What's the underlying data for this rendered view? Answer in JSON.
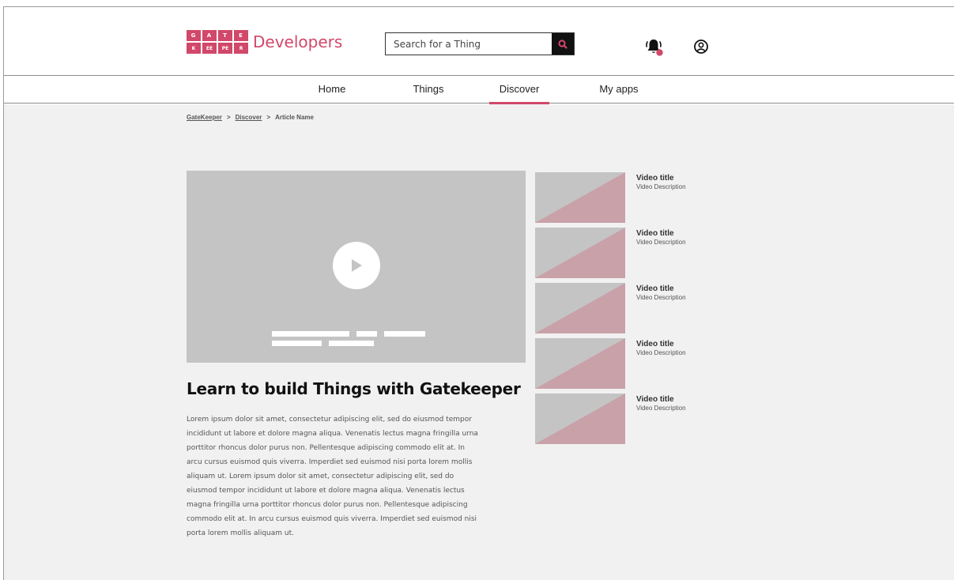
{
  "brand": {
    "logo_letters": [
      "G",
      "A",
      "T",
      "E",
      "K",
      "E",
      "E",
      "P",
      "E",
      "R"
    ],
    "name": "Developers",
    "accent_color": "#d1486a"
  },
  "search": {
    "placeholder": "Search for a Thing",
    "icon": "search-icon"
  },
  "header_icons": {
    "notifications": "bell-icon",
    "account": "account-icon"
  },
  "nav": {
    "items": [
      {
        "label": "Home",
        "active": false
      },
      {
        "label": "Things",
        "active": false
      },
      {
        "label": "Discover",
        "active": true
      },
      {
        "label": "My apps",
        "active": false
      }
    ]
  },
  "breadcrumb": {
    "items": [
      "GateKeeper",
      "Discover",
      "Article Name"
    ],
    "separator": ">"
  },
  "article": {
    "title": "Learn to build Things with Gatekeeper",
    "body": "Lorem ipsum dolor sit amet, consectetur adipiscing elit, sed do eiusmod tempor incididunt ut labore et dolore magna aliqua. Venenatis lectus magna fringilla urna porttitor rhoncus dolor purus non. Pellentesque adipiscing commodo elit at. In arcu cursus euismod quis viverra. Imperdiet sed euismod nisi porta lorem mollis aliquam ut.  Lorem ipsum dolor sit amet, consectetur adipiscing elit, sed do eiusmod tempor incididunt ut labore et dolore magna aliqua. Venenatis lectus magna fringilla urna porttitor rhoncus dolor purus non. Pellentesque adipiscing commodo elit at. In arcu cursus euismod quis viverra. Imperdiet sed euismod nisi porta lorem mollis aliquam ut."
  },
  "videos": [
    {
      "title": "Video title",
      "description": "Video Description"
    },
    {
      "title": "Video title",
      "description": "Video Description"
    },
    {
      "title": "Video title",
      "description": "Video Description"
    },
    {
      "title": "Video title",
      "description": "Video Description"
    },
    {
      "title": "Video title",
      "description": "Video Description"
    }
  ]
}
